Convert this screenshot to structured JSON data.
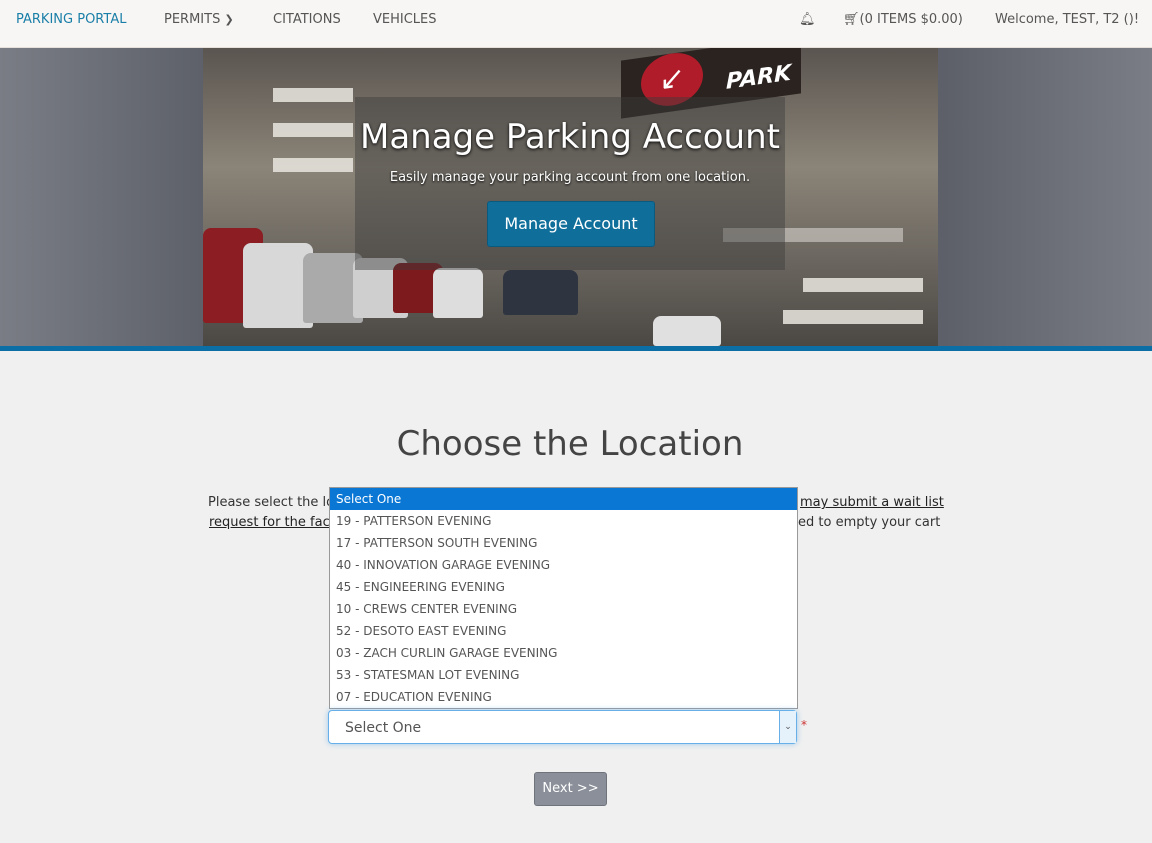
{
  "nav": {
    "brand": "PARKING PORTAL",
    "items": [
      "PERMITS",
      "CITATIONS",
      "VEHICLES"
    ],
    "cart": "(0 ITEMS $0.00)",
    "welcome": "Welcome, TEST, T2 ()!"
  },
  "hero": {
    "sign": "PARK",
    "title": "Manage Parking Account",
    "subtitle": "Easily manage your parking account from one location.",
    "button": "Manage Account"
  },
  "main": {
    "title": "Choose the Location",
    "instructions_visible": {
      "line1_start": "Please select the lo",
      "line1_end": "may submit a wait list",
      "line2_start": "request for the faci",
      "line2_end": "ed to empty your cart"
    },
    "dropdown_options": [
      "Select One",
      "19 - PATTERSON EVENING",
      "17 - PATTERSON SOUTH EVENING",
      "40 - INNOVATION GARAGE EVENING",
      "45 - ENGINEERING EVENING",
      "10 - CREWS CENTER EVENING",
      "52 - DESOTO EAST EVENING",
      "03 - ZACH CURLIN GARAGE EVENING",
      "53 - STATESMAN LOT EVENING",
      "07 - EDUCATION EVENING"
    ],
    "select_value": "Select One",
    "required_mark": "*",
    "next": "Next >>"
  },
  "colors": {
    "brand": "#1a7fa8",
    "accent_bar": "#0b6fa6",
    "highlight": "#0a77d5"
  }
}
